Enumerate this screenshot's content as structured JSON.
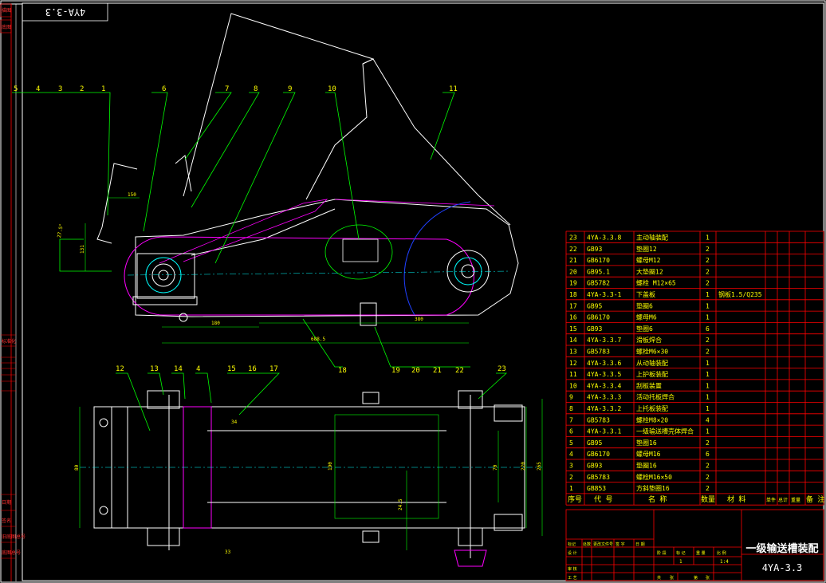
{
  "drawing": {
    "title": "一级输送槽装配",
    "code": "4YA-3.3",
    "code_mirrored": "4YA-3.3",
    "scale": "1:4",
    "sheet": "1"
  },
  "callouts_top": [
    "5",
    "4",
    "3",
    "2",
    "1",
    "6",
    "7",
    "8",
    "9",
    "10",
    "11"
  ],
  "callouts_mid": [
    "18",
    "19",
    "20",
    "21",
    "22"
  ],
  "callouts_bottom": [
    "12",
    "13",
    "14",
    "4",
    "15",
    "16",
    "17",
    "23"
  ],
  "dimensions": {
    "side_view": [
      "150",
      "27.5°",
      "131",
      "180",
      "688.5",
      "380"
    ],
    "plan_view": [
      "34",
      "80",
      "190",
      "24.5",
      "220",
      "265",
      "70",
      "33"
    ]
  },
  "bom": {
    "rows": [
      {
        "no": "23",
        "code": "4YA-3.3.8",
        "name": "主动轴装配",
        "qty": "1",
        "material": ""
      },
      {
        "no": "22",
        "code": "GB93",
        "name": "垫圈12",
        "qty": "2",
        "material": ""
      },
      {
        "no": "21",
        "code": "GB6170",
        "name": "螺母M12",
        "qty": "2",
        "material": ""
      },
      {
        "no": "20",
        "code": "GB95.1",
        "name": "大垫圈12",
        "qty": "2",
        "material": ""
      },
      {
        "no": "19",
        "code": "GB5782",
        "name": "螺栓 M12×65",
        "qty": "2",
        "material": ""
      },
      {
        "no": "18",
        "code": "4YA-3.3-1",
        "name": "下盖板",
        "qty": "1",
        "material": "钢板1.5/Q235"
      },
      {
        "no": "17",
        "code": "GB95",
        "name": "垫圈6",
        "qty": "1",
        "material": ""
      },
      {
        "no": "16",
        "code": "GB6170",
        "name": "螺母M6",
        "qty": "1",
        "material": ""
      },
      {
        "no": "15",
        "code": "GB93",
        "name": "垫圈6",
        "qty": "6",
        "material": ""
      },
      {
        "no": "14",
        "code": "4YA-3.3.7",
        "name": "滑板焊合",
        "qty": "2",
        "material": ""
      },
      {
        "no": "13",
        "code": "GB5783",
        "name": "螺栓M6×30",
        "qty": "2",
        "material": ""
      },
      {
        "no": "12",
        "code": "4YA-3.3.6",
        "name": "从动轴装配",
        "qty": "1",
        "material": ""
      },
      {
        "no": "11",
        "code": "4YA-3.3.5",
        "name": "上护板装配",
        "qty": "1",
        "material": ""
      },
      {
        "no": "10",
        "code": "4YA-3.3.4",
        "name": "刮板装置",
        "qty": "1",
        "material": ""
      },
      {
        "no": "9",
        "code": "4YA-3.3.3",
        "name": "活动托板焊合",
        "qty": "1",
        "material": ""
      },
      {
        "no": "8",
        "code": "4YA-3.3.2",
        "name": "上托板装配",
        "qty": "1",
        "material": ""
      },
      {
        "no": "7",
        "code": "GB5783",
        "name": "螺栓M8×20",
        "qty": "4",
        "material": ""
      },
      {
        "no": "6",
        "code": "4YA-3.3.1",
        "name": "一级输送槽壳体焊合",
        "qty": "1",
        "material": ""
      },
      {
        "no": "5",
        "code": "GB95",
        "name": "垫圈16",
        "qty": "2",
        "material": ""
      },
      {
        "no": "4",
        "code": "GB6170",
        "name": "螺母M16",
        "qty": "6",
        "material": ""
      },
      {
        "no": "3",
        "code": "GB93",
        "name": "垫圈16",
        "qty": "2",
        "material": ""
      },
      {
        "no": "2",
        "code": "GB5783",
        "name": "螺栓M16×50",
        "qty": "2",
        "material": ""
      },
      {
        "no": "1",
        "code": "GB853",
        "name": "方斜垫圈16",
        "qty": "2",
        "material": ""
      }
    ],
    "header": {
      "no": "序号",
      "code": "代  号",
      "name": "名    称",
      "qty": "数量",
      "material": "材  料",
      "single": "单件",
      "total": "总计",
      "weight": "重量",
      "remark": "备 注"
    }
  },
  "title_block": {
    "cells": [
      "标记",
      "处数",
      "更改文件号",
      "签 字",
      "日 期",
      "设 计",
      "审 核",
      "工 艺",
      "阶 段",
      "标 记",
      "重 量",
      "比 例",
      "共",
      "张",
      "第",
      "张"
    ]
  },
  "left_strip": [
    "描图",
    "底图",
    "标准化",
    "日期",
    "签名",
    "旧底图总号",
    "底图总号"
  ],
  "colors": {
    "background": "#000000",
    "frame": "#ffffff",
    "table": "#ff0000",
    "text": "#ffff00",
    "leader": "#00ff00",
    "belt": "#ff00ff",
    "axis": "#00ffff",
    "cover": "#0000ff"
  }
}
